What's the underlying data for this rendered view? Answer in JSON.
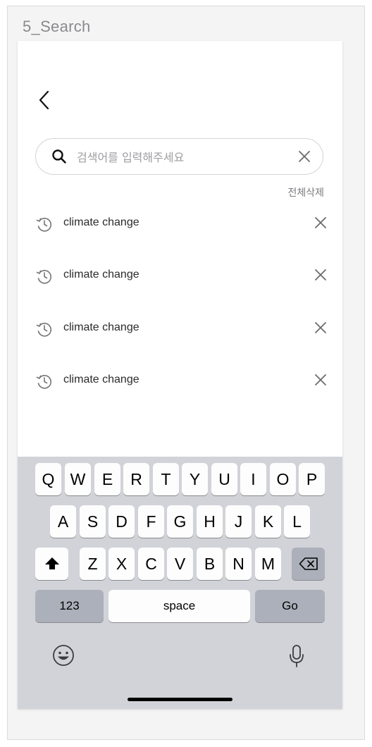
{
  "frame": {
    "title": "5_Search"
  },
  "search": {
    "placeholder": "검색어를 입력해주세요",
    "value": ""
  },
  "recent": {
    "delete_all_label": "전체삭제",
    "items": [
      {
        "label": "climate change"
      },
      {
        "label": "climate change"
      },
      {
        "label": "climate change"
      },
      {
        "label": "climate change"
      }
    ]
  },
  "keyboard": {
    "row1": [
      "Q",
      "W",
      "E",
      "R",
      "T",
      "Y",
      "U",
      "I",
      "O",
      "P"
    ],
    "row2": [
      "A",
      "S",
      "D",
      "F",
      "G",
      "H",
      "J",
      "K",
      "L"
    ],
    "row3": [
      "Z",
      "X",
      "C",
      "V",
      "B",
      "N",
      "M"
    ],
    "numbers_label": "123",
    "space_label": "space",
    "go_label": "Go",
    "icons": [
      "shift-icon",
      "backspace-icon",
      "emoji-icon",
      "microphone-icon"
    ]
  },
  "colors": {
    "keyboard_bg": "#d1d3d9",
    "key_bg": "#fdfdfd",
    "function_key_bg": "#abb0ba",
    "muted_text": "#7b7b80"
  }
}
